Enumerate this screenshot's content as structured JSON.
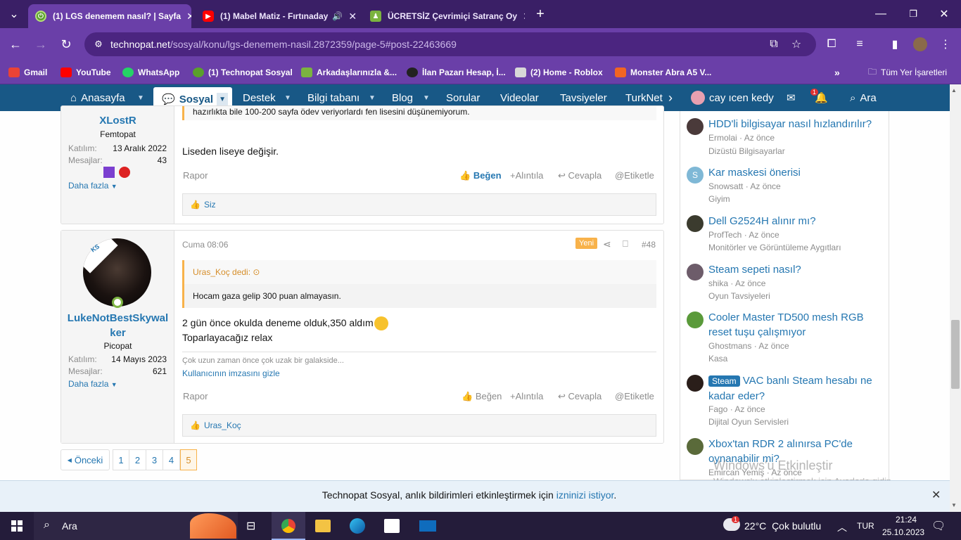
{
  "browser": {
    "tabs": [
      {
        "title": "(1) LGS denemem nasıl? | Sayfa",
        "active": true
      },
      {
        "title": "(1) Mabel Matiz - Fırtınaday",
        "active": false
      },
      {
        "title": "ÜCRETSİZ Çevrimiçi Satranç Oy",
        "active": false
      }
    ],
    "url_host": "technopat.net",
    "url_path": "/sosyal/konu/lgs-denemem-nasil.2872359/page-5#post-22463669",
    "bookmarks": [
      "Gmail",
      "YouTube",
      "WhatsApp",
      "(1) Technopat Sosyal",
      "Arkadaşlarınızla &...",
      "İlan Pazarı Hesap, İ...",
      "(2) Home - Roblox",
      "Monster Abra A5 V..."
    ],
    "bookmarks_folder": "Tüm Yer İşaretleri"
  },
  "nav": {
    "items": [
      "Anasayfa",
      "Sosyal",
      "Destek",
      "Bilgi tabanı",
      "Blog",
      "Sorular",
      "Videolar",
      "Tavsiyeler",
      "TurkNet"
    ],
    "user": "cay ıcen kedy",
    "notif_count": "1",
    "search": "Ara"
  },
  "post1": {
    "username": "XLostR",
    "user_title": "Femtopat",
    "joined_label": "Katılım:",
    "joined": "13 Aralık 2022",
    "messages_label": "Mesajlar:",
    "messages": "43",
    "more": "Daha fazla",
    "quote_tail": "hazırlıkta bile 100-200 sayfa ödev veriyorlardı fen lisesini düşünemiyorum.",
    "body": "Liseden liseye değişir.",
    "report": "Rapor",
    "like": "Beğen",
    "quote_btn": "Alıntıla",
    "reply": "Cevapla",
    "tag": "Etiketle",
    "reactions": "Siz"
  },
  "post2": {
    "avatar_letters": "KS",
    "username": "LukeNotBestSkywalker",
    "user_title": "Picopat",
    "joined_label": "Katılım:",
    "joined": "14 Mayıs 2023",
    "messages_label": "Mesajlar:",
    "messages": "621",
    "more": "Daha fazla",
    "date": "Cuma 08:06",
    "new_badge": "Yeni",
    "post_number": "#48",
    "quote_author": "Uras_Koç dedi:",
    "quote_text": "Hocam gaza gelip 300 puan almayasın.",
    "body_line1": "2 gün önce okulda deneme olduk,350 aldım",
    "body_line2": "Toparlayacağız relax",
    "signature": "Çok uzun zaman önce çok uzak bir galakside...",
    "hide_signature": "Kullanıcının imzasını gizle",
    "report": "Rapor",
    "like": "Beğen",
    "quote_btn": "Alıntıla",
    "reply": "Cevapla",
    "tag": "Etiketle",
    "reactions": "Uras_Koç"
  },
  "pagination": {
    "prev": "Önceki",
    "pages": [
      "1",
      "2",
      "3",
      "4",
      "5"
    ],
    "current": "5"
  },
  "sidebar": [
    {
      "title": "HDD'li bilgisayar nasıl hızlandırılır?",
      "author": "Ermolai",
      "time": "Az önce",
      "forum": "Dizüstü Bilgisayarlar",
      "avatar_color": "#4a3a3a"
    },
    {
      "title": "Kar maskesi önerisi",
      "author": "Snowsatt",
      "time": "Az önce",
      "forum": "Giyim",
      "avatar_color": "#7fb8d6",
      "avatar_letter": "S"
    },
    {
      "title": "Dell G2524H alınır mı?",
      "author": "ProfTech",
      "time": "Az önce",
      "forum": "Monitörler ve Görüntüleme Aygıtları",
      "avatar_color": "#3b3b2e"
    },
    {
      "title": "Steam sepeti nasıl?",
      "author": "shika",
      "time": "Az önce",
      "forum": "Oyun Tavsiyeleri",
      "avatar_color": "#6d5c6a"
    },
    {
      "title": "Cooler Master TD500 mesh RGB reset tuşu çalışmıyor",
      "author": "Ghostmans",
      "time": "Az önce",
      "forum": "Kasa",
      "avatar_color": "#5a9a3a"
    },
    {
      "title": "VAC banlı Steam hesabı ne kadar eder?",
      "badge": "Steam",
      "author": "Fago",
      "time": "Az önce",
      "forum": "Dijital Oyun Servisleri",
      "avatar_color": "#2a1e1a"
    },
    {
      "title": "Xbox'tan RDR 2 alınırsa PC'de oynanabilir mi?",
      "author": "Emircan Yemiş",
      "time": "Az önce",
      "forum": "",
      "avatar_color": "#5a6a3a"
    }
  ],
  "watermark": {
    "line1": "Windows'u Etkinleştir",
    "line2": "Windows'u etkinleştirmek için Ayarlar'a gidin."
  },
  "notification": {
    "prefix": "Technopat Sosyal, anlık bildirimleri etkinleştirmek için",
    "link": "izninizi istiyor",
    "suffix": "."
  },
  "taskbar": {
    "search": "Ara",
    "temp": "22°C",
    "weather": "Çok bulutlu",
    "lang": "TUR",
    "time": "21:24",
    "date": "25.10.2023"
  },
  "colors": {
    "chrome_dark": "#3a1f66",
    "chrome": "#6a3fa8",
    "site_nav": "#185886",
    "link": "#2577b1",
    "accent_orange": "#f8b24a"
  }
}
